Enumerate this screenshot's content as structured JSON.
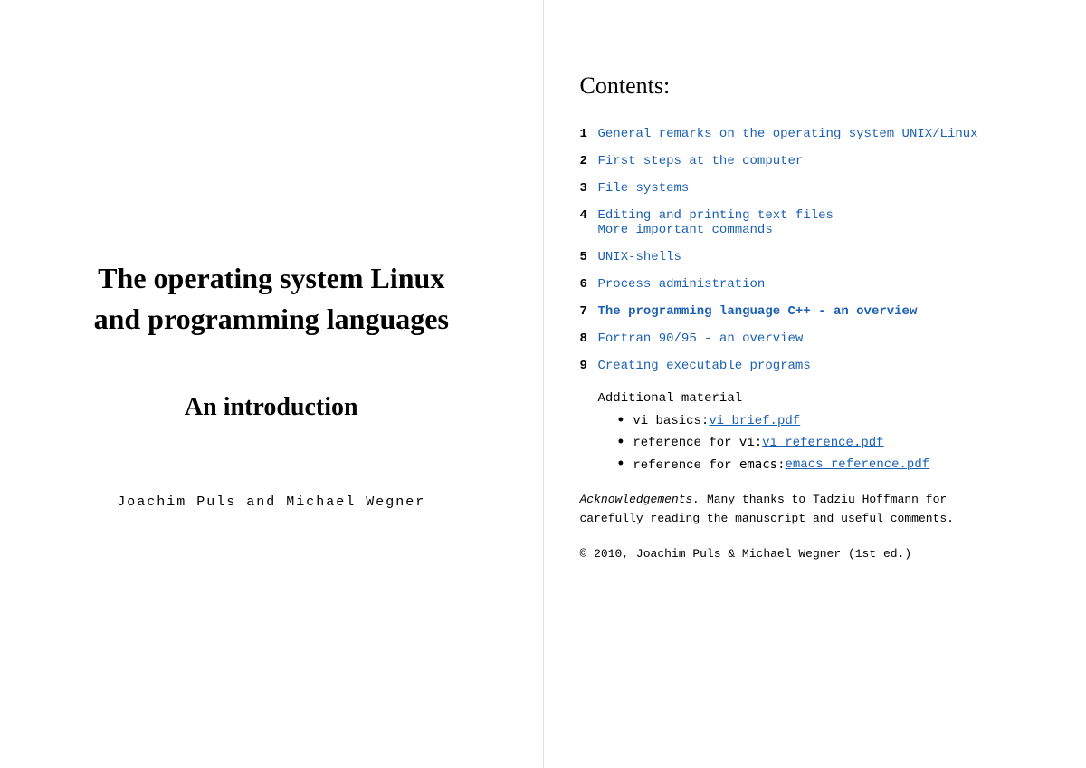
{
  "left": {
    "title_line1": "The operating system Linux",
    "title_line2": "and programming languages",
    "subtitle": "An introduction",
    "authors": "Joachim Puls and Michael Wegner"
  },
  "right": {
    "contents_heading": "Contents:",
    "toc": [
      {
        "number": "1",
        "text": "General remarks on the operating system UNIX/Linux",
        "bold": false,
        "multiline": false
      },
      {
        "number": "2",
        "text": "First steps at the computer",
        "bold": false,
        "multiline": false
      },
      {
        "number": "3",
        "text": "File systems",
        "bold": false,
        "multiline": false
      },
      {
        "number": "4",
        "text": "Editing and printing text files\nMore important commands",
        "bold": false,
        "multiline": true
      },
      {
        "number": "5",
        "text": "UNIX-shells",
        "bold": false,
        "multiline": false
      },
      {
        "number": "6",
        "text": "Process administration",
        "bold": false,
        "multiline": false
      },
      {
        "number": "7",
        "text": "The programming language C++ - an overview",
        "bold": true,
        "multiline": false
      },
      {
        "number": "8",
        "text": "Fortran 90/95 - an overview",
        "bold": false,
        "multiline": false
      },
      {
        "number": "9",
        "text": "Creating executable programs",
        "bold": false,
        "multiline": false
      }
    ],
    "additional_label": "Additional material",
    "bullets": [
      {
        "prefix": "vi basics: ",
        "link": "vi_brief.pdf"
      },
      {
        "prefix": "reference for vi: ",
        "link": "vi_reference.pdf"
      },
      {
        "prefix": "reference for emacs: ",
        "link": "emacs_reference.pdf"
      }
    ],
    "acknowledgements_italic": "Acknowledgements.",
    "acknowledgements_text": "  Many thanks to Tadziu Hoffmann for carefully reading the manuscript and useful comments.",
    "copyright": "©   2010, Joachim Puls & Michael Wegner (1st ed.)"
  }
}
